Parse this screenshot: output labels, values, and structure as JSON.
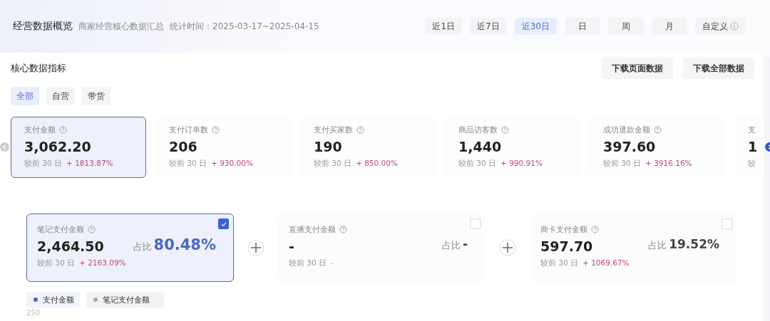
{
  "header": {
    "title": "经营数据概览",
    "subtitle": "商家经营核心数据汇总",
    "period": "统计时间：2025-03-17~2025-04-15"
  },
  "ranges": [
    {
      "label": "近1日",
      "selected": false
    },
    {
      "label": "近7日",
      "selected": false
    },
    {
      "label": "近30日",
      "selected": true
    },
    {
      "label": "日",
      "selected": false
    },
    {
      "label": "周",
      "selected": false
    },
    {
      "label": "月",
      "selected": false
    },
    {
      "label": "自定义",
      "selected": false,
      "info": true
    }
  ],
  "section": {
    "title": "核心数据指标",
    "buttons": [
      "下载页面数据",
      "下载全部数据"
    ]
  },
  "filters": [
    {
      "label": "全部",
      "selected": true
    },
    {
      "label": "自营",
      "selected": false
    },
    {
      "label": "带货",
      "selected": false
    }
  ],
  "metrics": [
    {
      "label": "支付金额",
      "value": "3,062.20",
      "compare": "较前 30 日",
      "change": "+ 1813.87%",
      "selected": true
    },
    {
      "label": "支付订单数",
      "value": "206",
      "compare": "较前 30 日",
      "change": "+ 930.00%",
      "selected": false
    },
    {
      "label": "支付买家数",
      "value": "190",
      "compare": "较前 30 日",
      "change": "+ 850.00%",
      "selected": false
    },
    {
      "label": "商品访客数",
      "value": "1,440",
      "compare": "较前 30 日",
      "change": "+ 990.91%",
      "selected": false
    },
    {
      "label": "成功退款金额",
      "value": "397.60",
      "compare": "较前 30 日",
      "change": "+ 3916.16%",
      "selected": false
    },
    {
      "label": "支",
      "value": "1",
      "compare": "较",
      "selected": false,
      "cut": true
    }
  ],
  "breakdown": [
    {
      "label": "笔记支付金额",
      "value": "2,464.50",
      "share_label": "占比",
      "share": "80.48%",
      "compare": "较前 30 日",
      "change": "+ 2163.09%",
      "checked": true
    },
    {
      "label": "直播支付金额",
      "value": "-",
      "share_label": "占比",
      "share": "-",
      "compare": "较前 30 日",
      "change": "-",
      "checked": false
    },
    {
      "label": "商卡支付金额",
      "value": "597.70",
      "share_label": "占比",
      "share": "19.52%",
      "compare": "较前 30 日",
      "change": "+ 1069.67%",
      "checked": false
    }
  ],
  "legend": [
    {
      "label": "支付金额",
      "color": "#4a63c8"
    },
    {
      "label": "笔记支付金额",
      "color": "#a8a8a8"
    }
  ],
  "axis_tick": "250"
}
